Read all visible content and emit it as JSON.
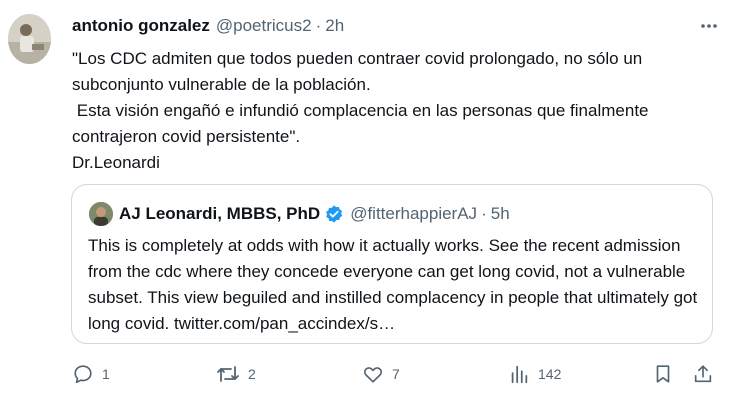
{
  "tweet": {
    "author_name": "antonio gonzalez",
    "author_handle": "@poetricus2",
    "separator": "·",
    "time": "2h",
    "text": "\"Los CDC admiten que todos pueden contraer covid prolongado, no sólo un subconjunto vulnerable de la población.\n Esta visión engañó e infundió complacencia en las personas que finalmente contrajeron covid persistente\".\nDr.Leonardi",
    "avatar_icon": "user-avatar-photo",
    "more_icon": "more-horizontal-icon"
  },
  "quoted": {
    "author_name": "AJ Leonardi, MBBS, PhD",
    "author_handle": "@fitterhappierAJ",
    "separator": "·",
    "time": "5h",
    "text": "This is completely at odds with how it actually works. See the recent admission from the cdc where they concede everyone can get long covid, not a vulnerable subset. This view beguiled and instilled complacency in people that ultimately got long covid. twitter.com/pan_accindex/s…",
    "verified_icon": "verified-badge-icon",
    "verified_color": "#1d9bf0"
  },
  "actions": {
    "reply_count": "1",
    "retweet_count": "2",
    "like_count": "7",
    "views_count": "142",
    "icons": [
      "reply-icon",
      "retweet-icon",
      "like-icon",
      "views-icon",
      "bookmark-icon",
      "share-icon"
    ]
  },
  "colors": {
    "text": "#0f1419",
    "secondary": "#536471",
    "border": "#cfd9de",
    "accent": "#1d9bf0"
  }
}
